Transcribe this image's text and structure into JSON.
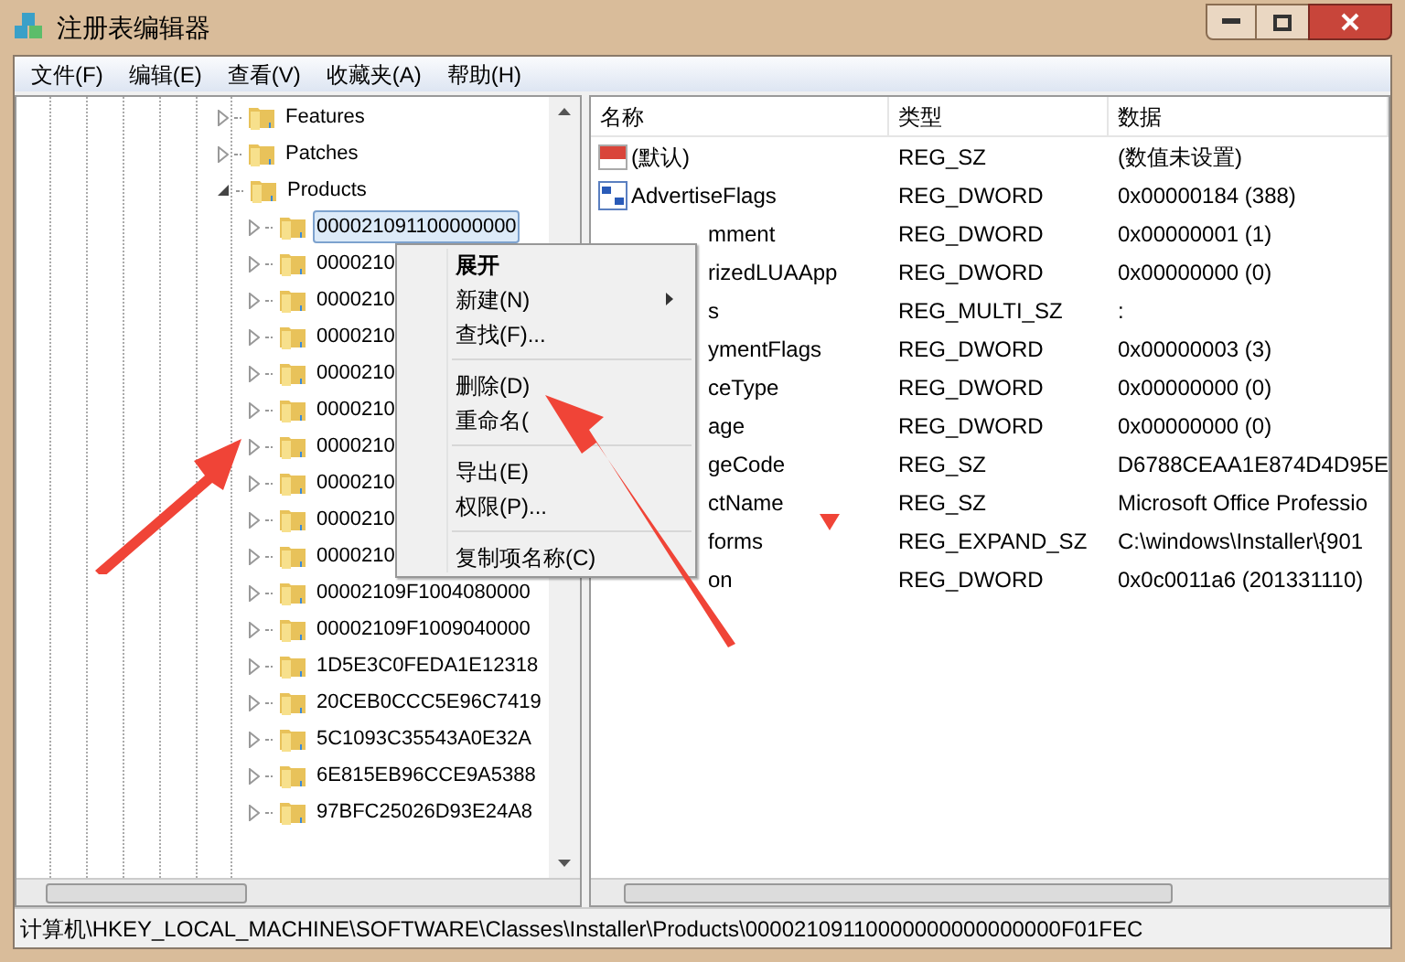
{
  "window": {
    "title": "注册表编辑器"
  },
  "menu": [
    "文件(F)",
    "编辑(E)",
    "查看(V)",
    "收藏夹(A)",
    "帮助(H)"
  ],
  "tree": [
    {
      "label": "Features",
      "expanded": false,
      "selected": false
    },
    {
      "label": "Patches",
      "expanded": false,
      "selected": false
    },
    {
      "label": "Products",
      "expanded": true,
      "selected": false,
      "children": [
        {
          "label": "000021091100000000",
          "expanded": false,
          "selected": true
        },
        {
          "label": "0000210",
          "expanded": false,
          "selected": false
        },
        {
          "label": "0000210",
          "expanded": false,
          "selected": false
        },
        {
          "label": "0000210",
          "expanded": false,
          "selected": false
        },
        {
          "label": "0000210",
          "expanded": false,
          "selected": false
        },
        {
          "label": "0000210",
          "expanded": false,
          "selected": false
        },
        {
          "label": "0000210",
          "expanded": false,
          "selected": false
        },
        {
          "label": "0000210",
          "expanded": false,
          "selected": false
        },
        {
          "label": "0000210",
          "expanded": false,
          "selected": false
        },
        {
          "label": "0000210",
          "expanded": false,
          "selected": false
        },
        {
          "label": "00002109F1004080000",
          "expanded": false,
          "selected": false
        },
        {
          "label": "00002109F1009040000",
          "expanded": false,
          "selected": false
        },
        {
          "label": "1D5E3C0FEDA1E12318",
          "expanded": false,
          "selected": false
        },
        {
          "label": "20CEB0CCC5E96C7419",
          "expanded": false,
          "selected": false
        },
        {
          "label": "5C1093C35543A0E32A",
          "expanded": false,
          "selected": false
        },
        {
          "label": "6E815EB96CCE9A5388",
          "expanded": false,
          "selected": false
        },
        {
          "label": "97BFC25026D93E24A8",
          "expanded": false,
          "selected": false
        }
      ]
    }
  ],
  "table": {
    "columns": [
      "名称",
      "类型",
      "数据"
    ],
    "rows": [
      {
        "kind": "string",
        "name": "(默认)",
        "type": "REG_SZ",
        "data": "(数值未设置)"
      },
      {
        "kind": "binary",
        "name": "AdvertiseFlags",
        "type": "REG_DWORD",
        "data": "0x00000184 (388)"
      },
      {
        "kind": "covered",
        "name": "mment",
        "type": "REG_DWORD",
        "data": "0x00000001 (1)"
      },
      {
        "kind": "covered",
        "name": "rizedLUAApp",
        "type": "REG_DWORD",
        "data": "0x00000000 (0)"
      },
      {
        "kind": "covered",
        "name": "s",
        "type": "REG_MULTI_SZ",
        "data": ":"
      },
      {
        "kind": "covered",
        "name": "ymentFlags",
        "type": "REG_DWORD",
        "data": "0x00000003 (3)"
      },
      {
        "kind": "covered",
        "name": "ceType",
        "type": "REG_DWORD",
        "data": "0x00000000 (0)"
      },
      {
        "kind": "covered",
        "name": "age",
        "type": "REG_DWORD",
        "data": "0x00000000 (0)"
      },
      {
        "kind": "covered",
        "name": "geCode",
        "type": "REG_SZ",
        "data": "D6788CEAA1E874D4D95E"
      },
      {
        "kind": "covered",
        "name": "ctName",
        "type": "REG_SZ",
        "data": "Microsoft Office Professio"
      },
      {
        "kind": "covered",
        "name": "forms",
        "type": "REG_EXPAND_SZ",
        "data": "C:\\windows\\Installer\\{901"
      },
      {
        "kind": "covered",
        "name": "on",
        "type": "REG_DWORD",
        "data": "0x0c0011a6 (201331110)"
      }
    ]
  },
  "context_menu": [
    {
      "kind": "item",
      "label": "展开",
      "bold": true,
      "submenu": false
    },
    {
      "kind": "item",
      "label": "新建(N)",
      "bold": false,
      "submenu": true
    },
    {
      "kind": "item",
      "label": "查找(F)...",
      "bold": false,
      "submenu": false
    },
    {
      "kind": "separator"
    },
    {
      "kind": "item",
      "label": "删除(D)",
      "bold": false,
      "submenu": false
    },
    {
      "kind": "item",
      "label": "重命名(",
      "bold": false,
      "submenu": false
    },
    {
      "kind": "separator"
    },
    {
      "kind": "item",
      "label": "导出(E)",
      "bold": false,
      "submenu": false
    },
    {
      "kind": "item",
      "label": "权限(P)...",
      "bold": false,
      "submenu": false
    },
    {
      "kind": "separator"
    },
    {
      "kind": "item",
      "label": "复制项名称(C)",
      "bold": false,
      "submenu": false
    }
  ],
  "status_bar": "计算机\\HKEY_LOCAL_MACHINE\\SOFTWARE\\Classes\\Installer\\Products\\00002109110000000000000000F01FEC"
}
